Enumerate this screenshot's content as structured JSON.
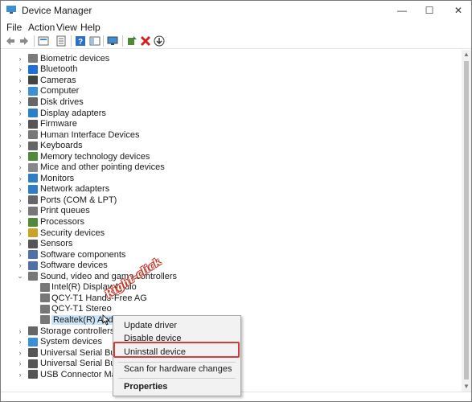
{
  "window": {
    "title": "Device Manager",
    "controls": {
      "minimize": "—",
      "maximize": "☐",
      "close": "✕"
    }
  },
  "menu": [
    "File",
    "Action",
    "View",
    "Help"
  ],
  "toolbar": {
    "icons": [
      "back-arrow-icon",
      "forward-arrow-icon",
      "device-manager-icon",
      "properties-icon",
      "help-icon",
      "view-icon",
      "monitor-icon",
      "add-driver-icon",
      "uninstall-x-icon",
      "download-icon"
    ]
  },
  "tree": {
    "categories": [
      {
        "label": "Biometric devices",
        "icon_color": "#7a7a7a"
      },
      {
        "label": "Bluetooth",
        "icon_color": "#1e6fd9"
      },
      {
        "label": "Cameras",
        "icon_color": "#444444"
      },
      {
        "label": "Computer",
        "icon_color": "#3b8fd6"
      },
      {
        "label": "Disk drives",
        "icon_color": "#666666"
      },
      {
        "label": "Display adapters",
        "icon_color": "#2a7fc9"
      },
      {
        "label": "Firmware",
        "icon_color": "#555555"
      },
      {
        "label": "Human Interface Devices",
        "icon_color": "#777777"
      },
      {
        "label": "Keyboards",
        "icon_color": "#666666"
      },
      {
        "label": "Memory technology devices",
        "icon_color": "#4f8a3a"
      },
      {
        "label": "Mice and other pointing devices",
        "icon_color": "#888888"
      },
      {
        "label": "Monitors",
        "icon_color": "#2f7dc7"
      },
      {
        "label": "Network adapters",
        "icon_color": "#2f7dc7"
      },
      {
        "label": "Ports (COM & LPT)",
        "icon_color": "#666666"
      },
      {
        "label": "Print queues",
        "icon_color": "#777777"
      },
      {
        "label": "Processors",
        "icon_color": "#4f8a3a"
      },
      {
        "label": "Security devices",
        "icon_color": "#c9a227"
      },
      {
        "label": "Sensors",
        "icon_color": "#555555"
      },
      {
        "label": "Software components",
        "icon_color": "#4f6fa8"
      },
      {
        "label": "Software devices",
        "icon_color": "#4f6fa8"
      },
      {
        "label": "Sound, video and game controllers",
        "icon_color": "#777777",
        "expanded": true
      }
    ],
    "sound_children": [
      {
        "label": "Intel(R) Display Audio",
        "icon_color": "#777777"
      },
      {
        "label": "QCY-T1 Hands-Free AG",
        "icon_color": "#777777"
      },
      {
        "label": "QCY-T1 Stereo",
        "icon_color": "#777777"
      },
      {
        "label": "Realtek(R) Audio",
        "icon_color": "#777777",
        "selected": true
      }
    ],
    "after": [
      {
        "label": "Storage controllers",
        "icon_color": "#666666"
      },
      {
        "label": "System devices",
        "icon_color": "#3b8fd6"
      },
      {
        "label": "Universal Serial Bus c",
        "icon_color": "#555555"
      },
      {
        "label": "Universal Serial Bus d",
        "icon_color": "#555555"
      },
      {
        "label": "USB Connector Mana",
        "icon_color": "#555555"
      }
    ]
  },
  "context_menu": {
    "update": "Update driver",
    "disable": "Disable device",
    "uninstall": "Uninstall device",
    "scan": "Scan for hardware changes",
    "properties": "Properties"
  },
  "annotation": "Right-click",
  "colors": {
    "highlight": "#d43c3c",
    "selection": "#cce4f7"
  }
}
